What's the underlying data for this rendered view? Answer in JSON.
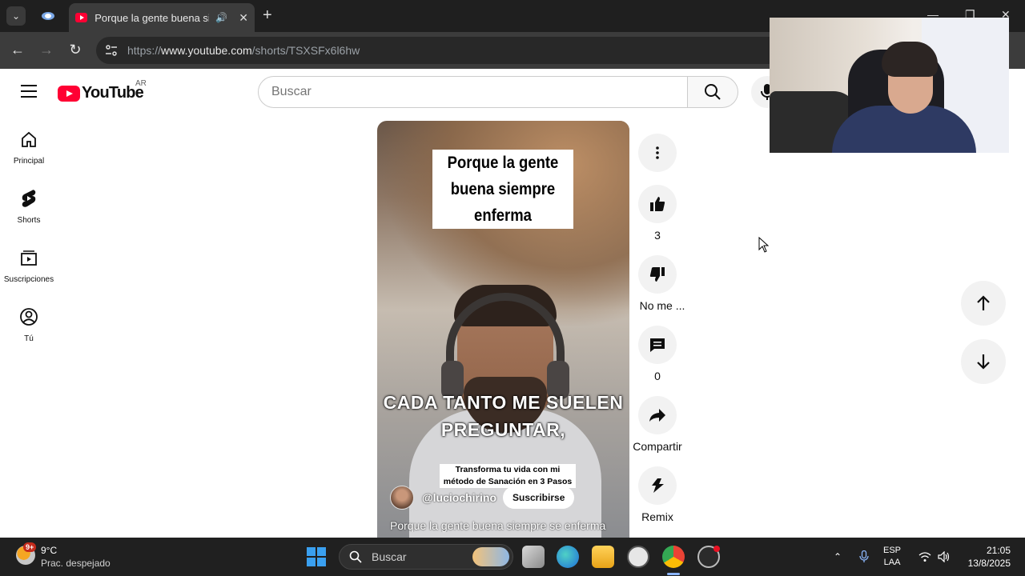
{
  "browser": {
    "tab_title": "Porque la gente buena siempre enferma - YouTube",
    "url_prefix": "https://",
    "url_host": "www.youtube.com",
    "url_path": "/shorts/TSXSFx6l6hw"
  },
  "youtube": {
    "logo_text": "YouTube",
    "country_code": "AR",
    "search_placeholder": "Buscar",
    "sidebar": [
      {
        "label": "Principal",
        "icon": "home-icon"
      },
      {
        "label": "Shorts",
        "icon": "shorts-icon"
      },
      {
        "label": "Suscripciones",
        "icon": "subscriptions-icon"
      },
      {
        "label": "Tú",
        "icon": "account-icon"
      }
    ]
  },
  "short": {
    "caption_title": "Porque la gente buena siempre enferma",
    "caption_big": "CADA TANTO ME SUELEN PREGUNTAR,",
    "caption_small": "Transforma tu vida con mi método de Sanación en 3 Pasos",
    "channel_handle": "@luciochirino",
    "subscribe_label": "Suscribirse",
    "description": "Porque la gente buena siempre se enferma",
    "actions": {
      "likes": "3",
      "dislike_label": "No me ...",
      "comments": "0",
      "share_label": "Compartir",
      "remix_label": "Remix"
    }
  },
  "taskbar": {
    "weather_badge": "9+",
    "weather_temp": "9°C",
    "weather_desc": "Prac. despejado",
    "search_placeholder": "Buscar",
    "lang_top": "ESP",
    "lang_bottom": "LAA",
    "time": "21:05",
    "date": "13/8/2025"
  },
  "colors": {
    "brand_red": "#ff0033",
    "taskbar_bg": "#202020",
    "chrome_bg": "#3c3c3c"
  }
}
